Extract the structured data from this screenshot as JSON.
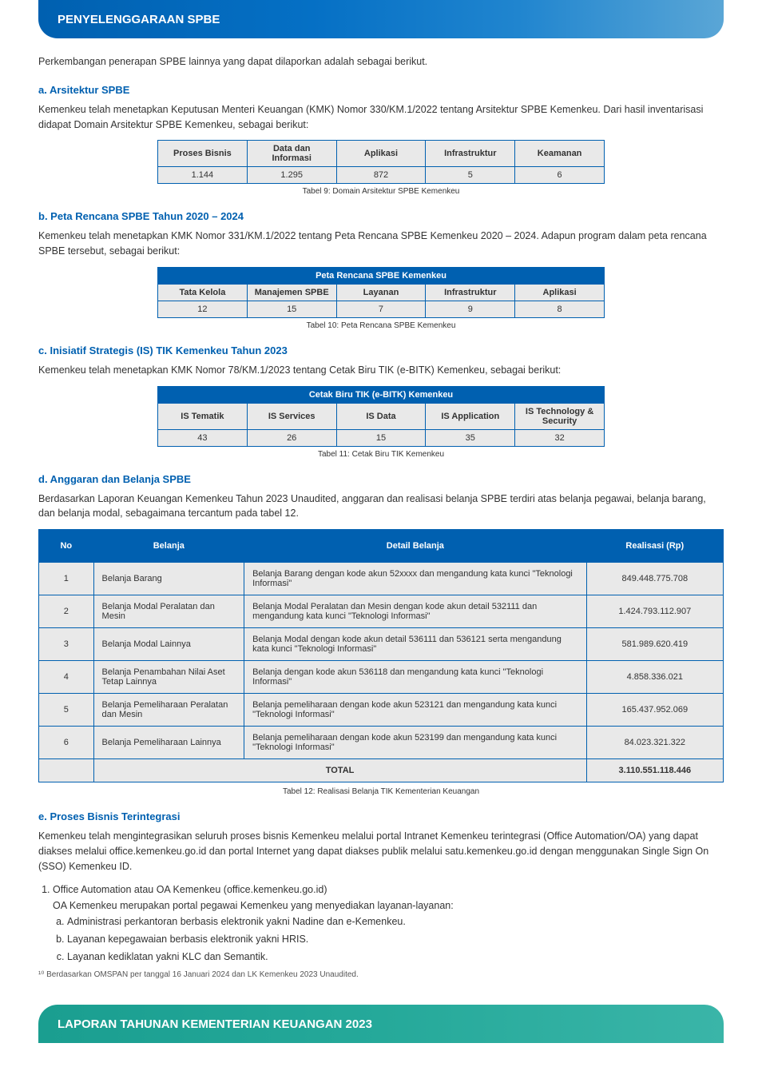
{
  "header": {
    "title": "PENYELENGGARAAN SPBE"
  },
  "intro": "Perkembangan penerapan SPBE lainnya yang dapat dilaporkan adalah sebagai berikut.",
  "s1": {
    "title": "a.  Arsitektur SPBE",
    "text": "Kemenkeu telah menetapkan Keputusan Menteri Keuangan (KMK) Nomor 330/KM.1/2022 tentang Arsitektur SPBE Kemenkeu. Dari hasil inventarisasi didapat Domain Arsitektur SPBE Kemenkeu, sebagai berikut:",
    "table_headers": [
      "Proses Bisnis",
      "Data dan Informasi",
      "Aplikasi",
      "Infrastruktur",
      "Keamanan"
    ],
    "table_row": [
      "1.144",
      "1.295",
      "872",
      "5",
      "6"
    ],
    "caption": "Tabel 9: Domain Arsitektur SPBE Kemenkeu"
  },
  "s2": {
    "title": "b.  Peta Rencana SPBE Tahun 2020 – 2024",
    "text": "Kemenkeu telah menetapkan KMK Nomor 331/KM.1/2022 tentang Peta Rencana SPBE Kemenkeu 2020 – 2024. Adapun program dalam peta rencana SPBE tersebut, sebagai berikut:",
    "table_head": "Peta Rencana SPBE Kemenkeu",
    "table_headers": [
      "Tata Kelola",
      "Manajemen SPBE",
      "Layanan",
      "Infrastruktur",
      "Aplikasi"
    ],
    "table_row": [
      "12",
      "15",
      "7",
      "9",
      "8"
    ],
    "caption": "Tabel 10: Peta Rencana SPBE Kemenkeu"
  },
  "s3": {
    "title": "c.  Inisiatif Strategis (IS) TIK Kemenkeu Tahun 2023",
    "text": "Kemenkeu telah menetapkan KMK Nomor 78/KM.1/2023 tentang Cetak Biru TIK (e-BITK) Kemenkeu, sebagai berikut:",
    "table_head": "Cetak Biru TIK (e-BITK) Kemenkeu",
    "table_headers": [
      "IS Tematik",
      "IS Services",
      "IS Data",
      "IS Application",
      "IS Technology & Security"
    ],
    "table_row": [
      "43",
      "26",
      "15",
      "35",
      "32"
    ],
    "caption": "Tabel 11: Cetak Biru TIK Kemenkeu"
  },
  "s4": {
    "title": "d.  Anggaran dan Belanja SPBE",
    "text": "Berdasarkan Laporan Keuangan Kemenkeu Tahun 2023 Unaudited, anggaran dan realisasi belanja SPBE terdiri atas belanja pegawai, belanja barang, dan belanja modal, sebagaimana tercantum pada tabel 12.",
    "table_headers": [
      "No",
      "Belanja",
      "Detail Belanja",
      "Realisasi (Rp)"
    ],
    "rows": [
      {
        "no": "1",
        "belanja": "Belanja Barang",
        "detail": "Belanja Barang dengan kode akun 52xxxx dan mengandung kata kunci \"Teknologi Informasi\"",
        "realisasi": "849.448.775.708"
      },
      {
        "no": "2",
        "belanja": "Belanja Modal Peralatan dan Mesin",
        "detail": "Belanja Modal Peralatan dan Mesin dengan kode akun detail 532111 dan mengandung kata kunci \"Teknologi Informasi\"",
        "realisasi": "1.424.793.112.907"
      },
      {
        "no": "3",
        "belanja": "Belanja Modal Lainnya",
        "detail": "Belanja Modal dengan kode akun detail 536111 dan 536121 serta mengandung kata kunci \"Teknologi Informasi\"",
        "realisasi": "581.989.620.419"
      },
      {
        "no": "4",
        "belanja": "Belanja Penambahan Nilai Aset Tetap Lainnya",
        "detail": "Belanja dengan kode akun 536118 dan mengandung kata kunci \"Teknologi Informasi\"",
        "realisasi": "4.858.336.021"
      },
      {
        "no": "5",
        "belanja": "Belanja Pemeliharaan Peralatan dan Mesin",
        "detail": "Belanja pemeliharaan dengan kode akun 523121 dan mengandung kata kunci \"Teknologi Informasi\"",
        "realisasi": "165.437.952.069"
      },
      {
        "no": "6",
        "belanja": "Belanja Pemeliharaan Lainnya",
        "detail": "Belanja pemeliharaan dengan kode akun 523199 dan mengandung kata kunci \"Teknologi Informasi\"",
        "realisasi": "84.023.321.322"
      },
      {
        "no": "",
        "belanja": "TOTAL",
        "detail": "",
        "realisasi": "3.110.551.118.446"
      }
    ],
    "caption": "Tabel 12: Realisasi Belanja TIK Kementerian Keuangan"
  },
  "s5": {
    "title": "e.  Proses Bisnis Terintegrasi",
    "text": "Kemenkeu telah mengintegrasikan seluruh proses bisnis Kemenkeu melalui portal Intranet Kemenkeu terintegrasi (Office Automation/OA) yang dapat diakses melalui office.kemenkeu.go.id dan portal Internet yang dapat diakses publik melalui satu.kemenkeu.go.id dengan menggunakan Single Sign On (SSO) Kemenkeu ID.",
    "li1": "Office Automation atau OA Kemenkeu (office.kemenkeu.go.id)",
    "li1_text": "OA Kemenkeu merupakan portal pegawai Kemenkeu yang menyediakan layanan-layanan:",
    "sub": [
      "Administrasi perkantoran berbasis elektronik yakni Nadine dan e-Kemenkeu.",
      "Layanan kepegawaian berbasis elektronik yakni HRIS.",
      "Layanan kediklatan yakni KLC dan Semantik."
    ]
  },
  "note": "¹⁰ Berdasarkan OMSPAN per tanggal 16 Januari 2024 dan LK Kemenkeu 2023 Unaudited.",
  "footer": "LAPORAN TAHUNAN KEMENTERIAN KEUANGAN 2023"
}
